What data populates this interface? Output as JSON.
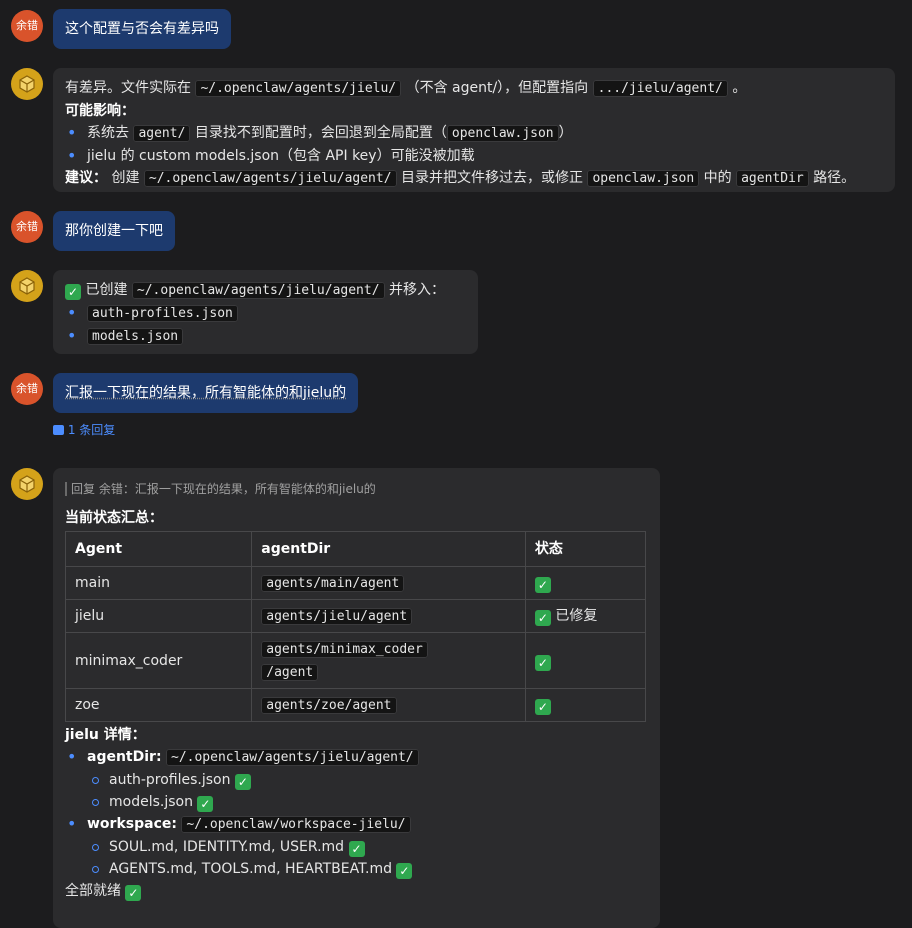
{
  "user_avatar_label": "余错",
  "messages": {
    "m1": {
      "text": "这个配置与否会有差异吗"
    },
    "m2": {
      "p1_a": "有差异。文件实际在",
      "p1_code1": "~/.openclaw/agents/jielu/",
      "p1_b": "（不含 agent/），但配置指向",
      "p1_code2": ".../jielu/agent/",
      "p1_c": "。",
      "impact_title": "可能影响：",
      "b1_a": "系统去",
      "b1_code1": "agent/",
      "b1_b": "目录找不到配置时，会回退到全局配置（",
      "b1_code2": "openclaw.json",
      "b1_c": "）",
      "b2": "jielu 的 custom models.json（包含 API key）可能没被加载",
      "sugg_title": "建议：",
      "sugg_a": "创建",
      "sugg_code1": "~/.openclaw/agents/jielu/agent/",
      "sugg_b": "目录并把文件移过去，或修正",
      "sugg_code2": "openclaw.json",
      "sugg_c": "中的",
      "sugg_code3": "agentDir",
      "sugg_d": "路径。"
    },
    "m3": {
      "text": "那你创建一下吧"
    },
    "m4": {
      "a": "已创建",
      "code": "~/.openclaw/agents/jielu/agent/",
      "b": "并移入：",
      "items": [
        "auth-profiles.json",
        "models.json"
      ]
    },
    "m5": {
      "text": "汇报一下现在的结果，所有智能体的和jielu的"
    },
    "reply_count": "1 条回复",
    "m6": {
      "quote": "回复 余错：汇报一下现在的结果，所有智能体的和jielu的",
      "summary_title": "当前状态汇总：",
      "table": {
        "headers": [
          "Agent",
          "agentDir",
          "状态"
        ],
        "rows": [
          {
            "agent": "main",
            "dir": "agents/main/agent",
            "status": ""
          },
          {
            "agent": "jielu",
            "dir": "agents/jielu/agent",
            "status": "已修复"
          },
          {
            "agent": "minimax_coder",
            "dir1": "agents/minimax_coder",
            "dir2": "/agent",
            "status": ""
          },
          {
            "agent": "zoe",
            "dir": "agents/zoe/agent",
            "status": ""
          }
        ]
      },
      "detail_title": "jielu 详情：",
      "agentdir_label": "agentDir:",
      "agentdir_path": "~/.openclaw/agents/jielu/agent/",
      "agentdir_files": [
        "auth-profiles.json",
        "models.json"
      ],
      "workspace_label": "workspace:",
      "workspace_path": "~/.openclaw/workspace-jielu/",
      "workspace_files": [
        "SOUL.md, IDENTITY.md, USER.md",
        "AGENTS.md, TOOLS.md, HEARTBEAT.md"
      ],
      "final": "全部就绪"
    }
  },
  "colors": {
    "user_bubble": "#1d3a6e",
    "bot_bubble": "#2b2b2d",
    "accent": "#4c8dff",
    "check": "#2fa84f"
  }
}
